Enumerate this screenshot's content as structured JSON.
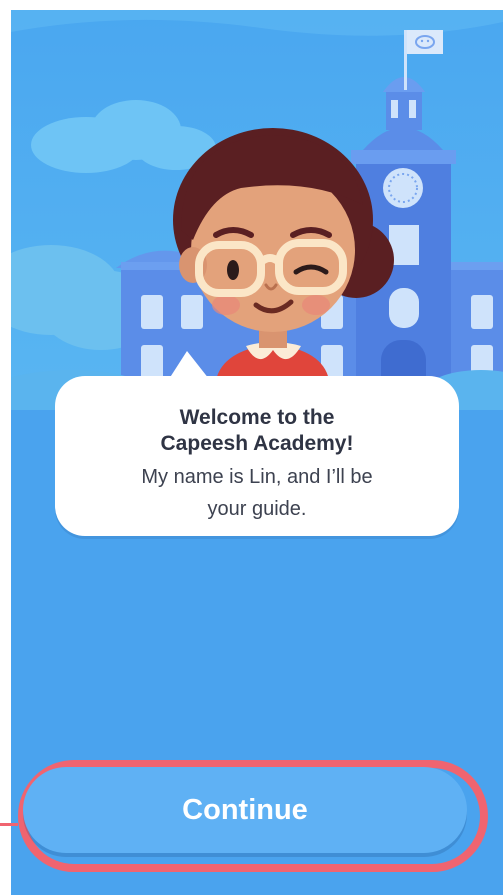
{
  "scene": {
    "character": "lin-teacher-illustration",
    "background": "capeesh-academy-building-illustration",
    "flag_icon": "capeesh-logo-flag-icon"
  },
  "dialog": {
    "title": "Welcome to the\nCapeesh Academy!",
    "body": "My name is Lin, and I’ll be\nyour guide."
  },
  "actions": {
    "continue_label": "Continue"
  },
  "colors": {
    "background": "#4aa3ee",
    "button": "#5fb1f4",
    "highlight": "#f06470"
  }
}
